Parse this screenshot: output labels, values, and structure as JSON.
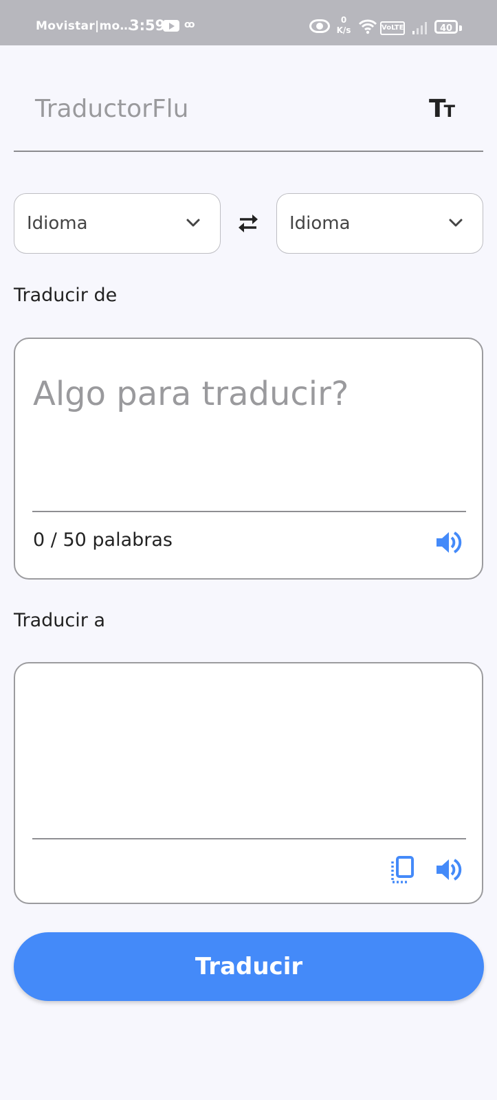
{
  "status_bar": {
    "carrier": "Movistar|mo…",
    "time": "3:59",
    "voicemail": "ꝏ",
    "net_speed_value": "0",
    "net_speed_unit": "K/s",
    "volte": "VoLTE",
    "battery": "40"
  },
  "app_bar": {
    "title": "TraductorFlu",
    "font_icon_big": "T",
    "font_icon_small": "T"
  },
  "languages": {
    "source_label": "Idioma",
    "target_label": "Idioma"
  },
  "source": {
    "section_label": "Traducir de",
    "placeholder": "Algo para traducir?",
    "counter": "0 / 50 palabras"
  },
  "target": {
    "section_label": "Traducir a",
    "value": ""
  },
  "actions": {
    "translate_label": "Traducir"
  },
  "colors": {
    "accent": "#448af9",
    "background": "#f7f7fd",
    "status_bar": "#b7b7bd"
  },
  "icons": {
    "font_size": "text-size-icon",
    "swap": "swap-arrows-icon",
    "speaker": "volume-up-icon",
    "copy": "copy-icon",
    "dropdown": "chevron-down-icon"
  }
}
